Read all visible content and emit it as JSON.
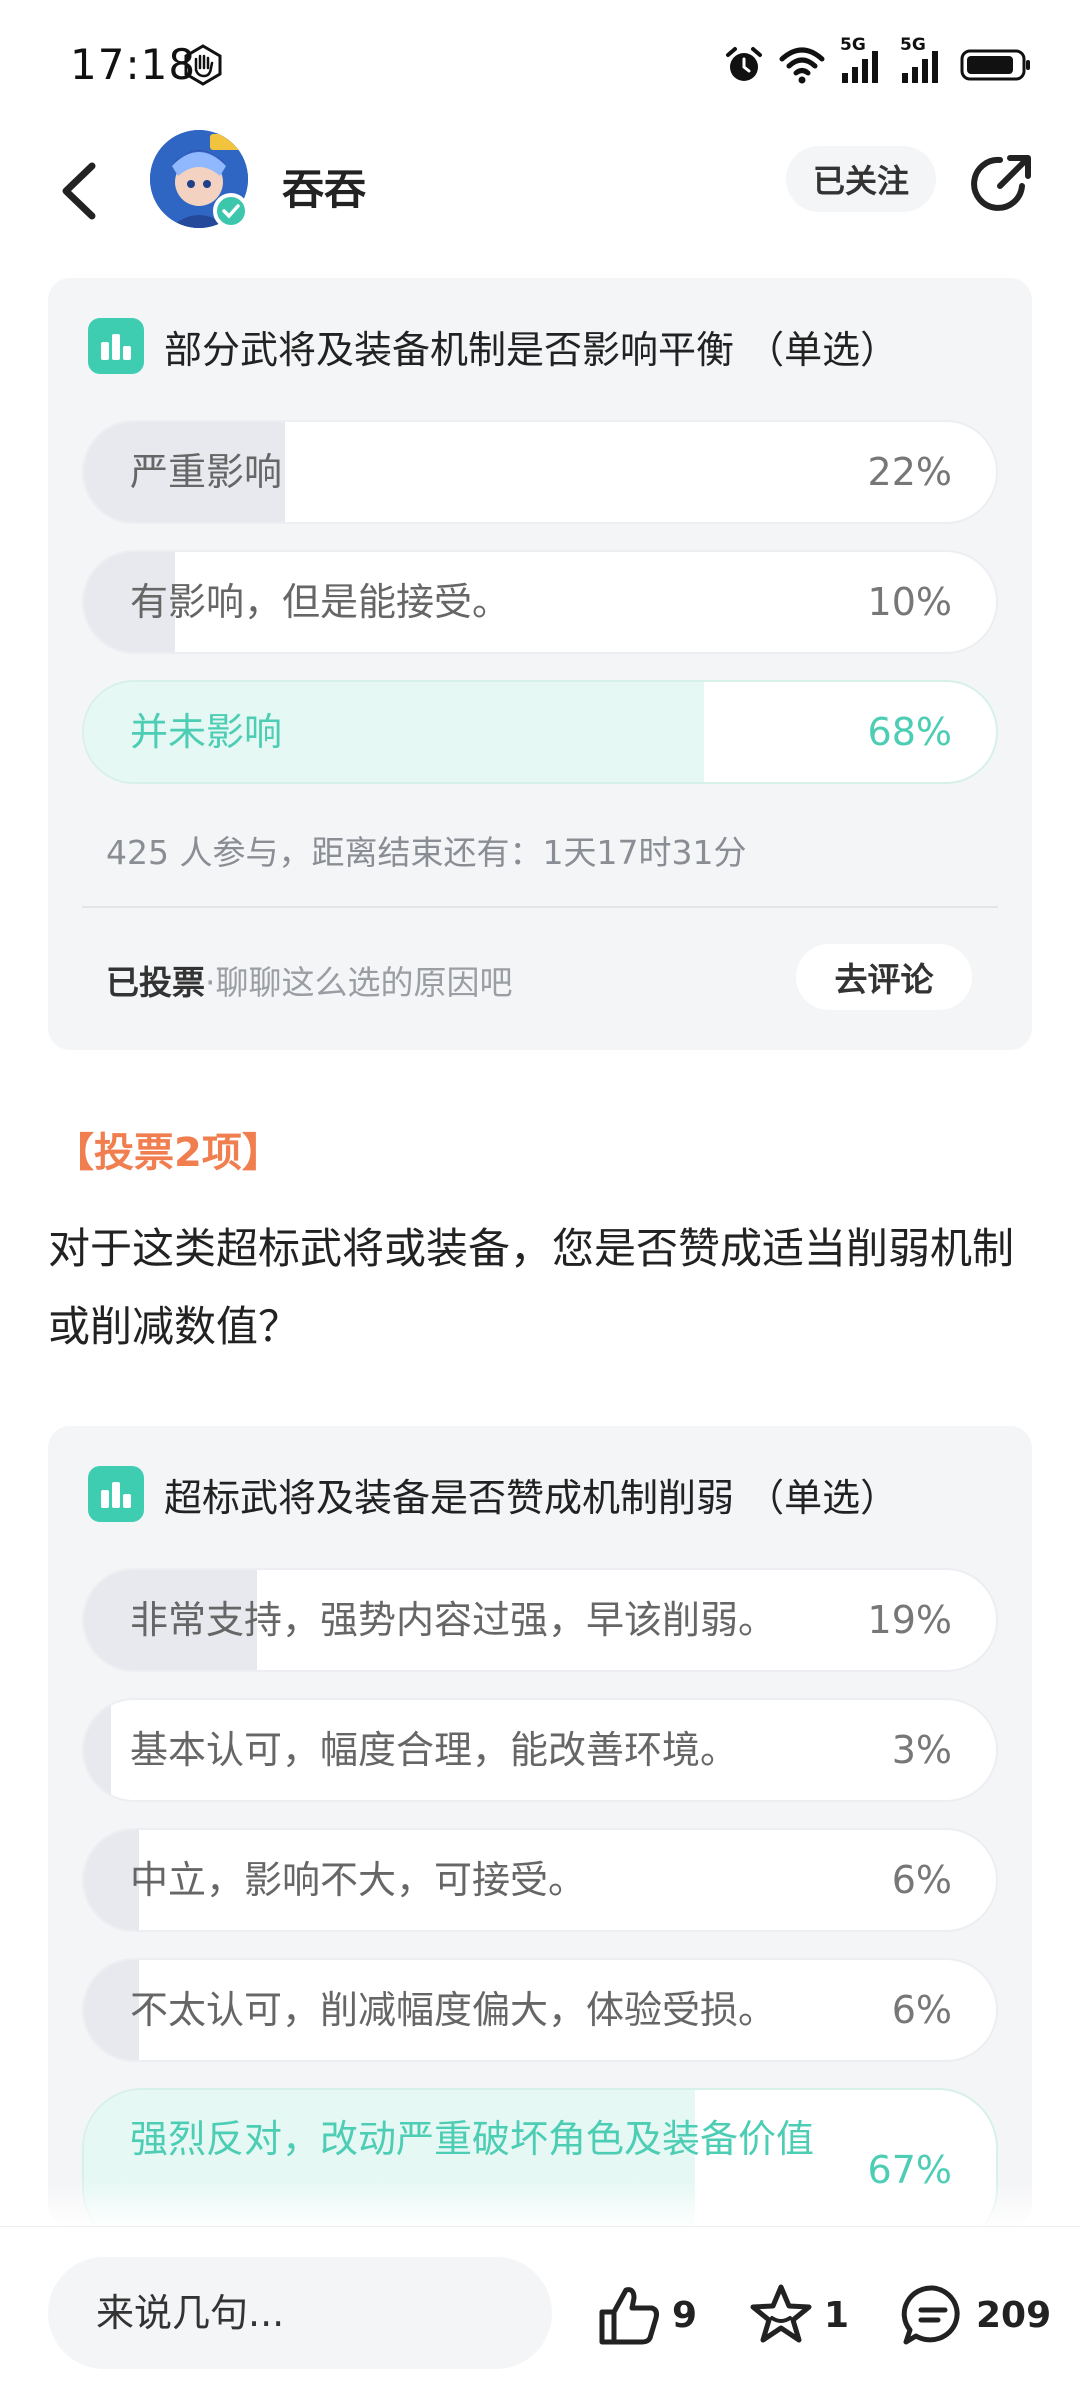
{
  "status_bar": {
    "time": "17:18",
    "network_1": "5G",
    "network_2": "5G",
    "icons": [
      "hand-icon",
      "alarm-icon",
      "wifi-icon",
      "signal-icon",
      "signal-icon",
      "battery-icon"
    ]
  },
  "header": {
    "username": "吞吞",
    "follow_label": "已关注",
    "icons": [
      "back-arrow-icon",
      "verified-icon",
      "share-icon"
    ]
  },
  "poll1": {
    "title": "部分武将及装备机制是否影响平衡 （单选）",
    "options": [
      {
        "label": "严重影响",
        "percent": "22%",
        "value": 22,
        "selected": false
      },
      {
        "label": "有影响，但是能接受。",
        "percent": "10%",
        "value": 10,
        "selected": false
      },
      {
        "label": "并未影响",
        "percent": "68%",
        "value": 68,
        "selected": true
      }
    ],
    "meta": "425 人参与，距离结束还有：1天17时31分",
    "voted_label": "已投票",
    "voted_hint": "·聊聊这么选的原因吧",
    "comment_button": "去评论"
  },
  "section": {
    "tag": "【投票2项】",
    "question": "对于这类超标武将或装备，您是否赞成适当削弱机制或削减数值？"
  },
  "poll2": {
    "title": "超标武将及装备是否赞成机制削弱 （单选）",
    "options": [
      {
        "label": "非常支持，强势内容过强，早该削弱。",
        "percent": "19%",
        "value": 19,
        "selected": false
      },
      {
        "label": "基本认可，幅度合理，能改善环境。",
        "percent": "3%",
        "value": 3,
        "selected": false
      },
      {
        "label": "中立，影响不大，可接受。",
        "percent": "6%",
        "value": 6,
        "selected": false
      },
      {
        "label": "不太认可，削减幅度偏大，体验受损。",
        "percent": "6%",
        "value": 6,
        "selected": false
      },
      {
        "label": "强烈反对，改动严重破坏角色及装备价值",
        "percent": "67%",
        "value": 67,
        "selected": true
      }
    ]
  },
  "bottom_bar": {
    "input_placeholder": "来说几句...",
    "like_count": "9",
    "favorite_count": "1",
    "comment_count": "209",
    "icons": [
      "thumbs-up-icon",
      "star-icon",
      "comment-icon"
    ]
  },
  "colors": {
    "accent": "#3ecdb1",
    "selected_text": "#4ccdb4",
    "tag": "#f07e4f",
    "card_bg": "#f4f5f7"
  }
}
